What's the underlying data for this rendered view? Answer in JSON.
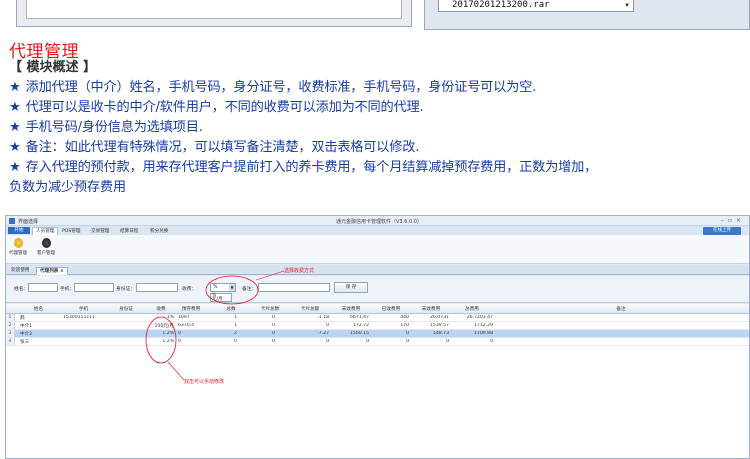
{
  "top": {
    "rar_filename": "20170201213200.rar"
  },
  "doc": {
    "title": "代理管理",
    "module_heading": "【 模块概述 】",
    "bullet_star": "★",
    "bullets": [
      "添加代理（中介）姓名，手机号码，身分证号，收费标准，手机号码，身份证号可以为空.",
      "代理可以是收卡的中介/软件用户，不同的收费可以添加为不同的代理.",
      "手机号码/身份信息为选填项目.",
      "备注：如此代理有特殊情况，可以填写备注清楚，双击表格可以修改.",
      "存入代理的预付款，用来存代理客户提前打入的养卡费用，每个月结算减掉预存费用，正数为增加，"
    ],
    "bullet_continuation": "负数为减少预存费用"
  },
  "app": {
    "title": "通元金融信用卡管理软件（V3.6.0.0）",
    "skin_label": "界面选择",
    "menu": {
      "start": "开始",
      "items": [
        "人员管理",
        "POS管理",
        "交易管理",
        "结算日程",
        "积分兑换"
      ]
    },
    "online_button": "在线上传",
    "ribbon": {
      "agent_mgmt": "代理管理",
      "customer_mgmt": "客户管理"
    },
    "tabs": [
      "欢迎使用",
      "代理列表"
    ],
    "tab_close": "×",
    "filter": {
      "name_label": "姓名：",
      "phone_label": "手机：",
      "id_label": "身份证：",
      "fee_label": "收费：",
      "fee_value": "%",
      "fee_options": [
        "%",
        "元/月"
      ],
      "remark_label": "备注：",
      "save_button": "保 存"
    },
    "columns": [
      "姓名",
      "手机",
      "身份证",
      "收费",
      "预存费用",
      "总数",
      "卡片总数",
      "卡片总额",
      "未收费用",
      "已收费用",
      "未收费用",
      "总费用",
      "备注"
    ],
    "rows": [
      {
        "idx": "1",
        "name": "郝",
        "phone": "15300111111",
        "id": "",
        "fee": "1%",
        "prepaid": "1097",
        "count": "1",
        "cards": "0",
        "amount": "-1.18",
        "unpaid": "6671.47",
        "paid": "440",
        "unpaid2": "26,0731",
        "total": "26,7201.47",
        "remark": ""
      },
      {
        "idx": "2",
        "name": "中介1",
        "phone": "",
        "id": "",
        "fee": "100元/月",
        "prepaid": "6370.4",
        "count": "1",
        "cards": "0",
        "amount": "0",
        "unpaid": "172.72",
        "paid": "170",
        "unpaid2": "1539.57",
        "total": "1712.29",
        "remark": ""
      },
      {
        "idx": "3",
        "name": "中介2",
        "phone": "",
        "id": "",
        "fee": "1.2%",
        "prepaid": "0",
        "count": "2",
        "cards": "0",
        "amount": "-7.27",
        "unpaid": "1560.15",
        "paid": "0",
        "unpaid2": "148.73",
        "total": "1709.88",
        "remark": ""
      },
      {
        "idx": "4",
        "name": "张三",
        "phone": "",
        "id": "",
        "fee": "1.2%",
        "prepaid": "0",
        "count": "0",
        "cards": "0",
        "amount": "0",
        "unpaid": "0",
        "paid": "0",
        "unpaid2": "0",
        "total": "0",
        "remark": ""
      }
    ],
    "annotations": {
      "fee_mode": "选择收费方式",
      "double_click": "双击可以手动修改"
    },
    "colors": {
      "annotation": "#e8141c",
      "bullet_text": "#1a3da7",
      "selected_row": "#b9d3f2"
    }
  }
}
